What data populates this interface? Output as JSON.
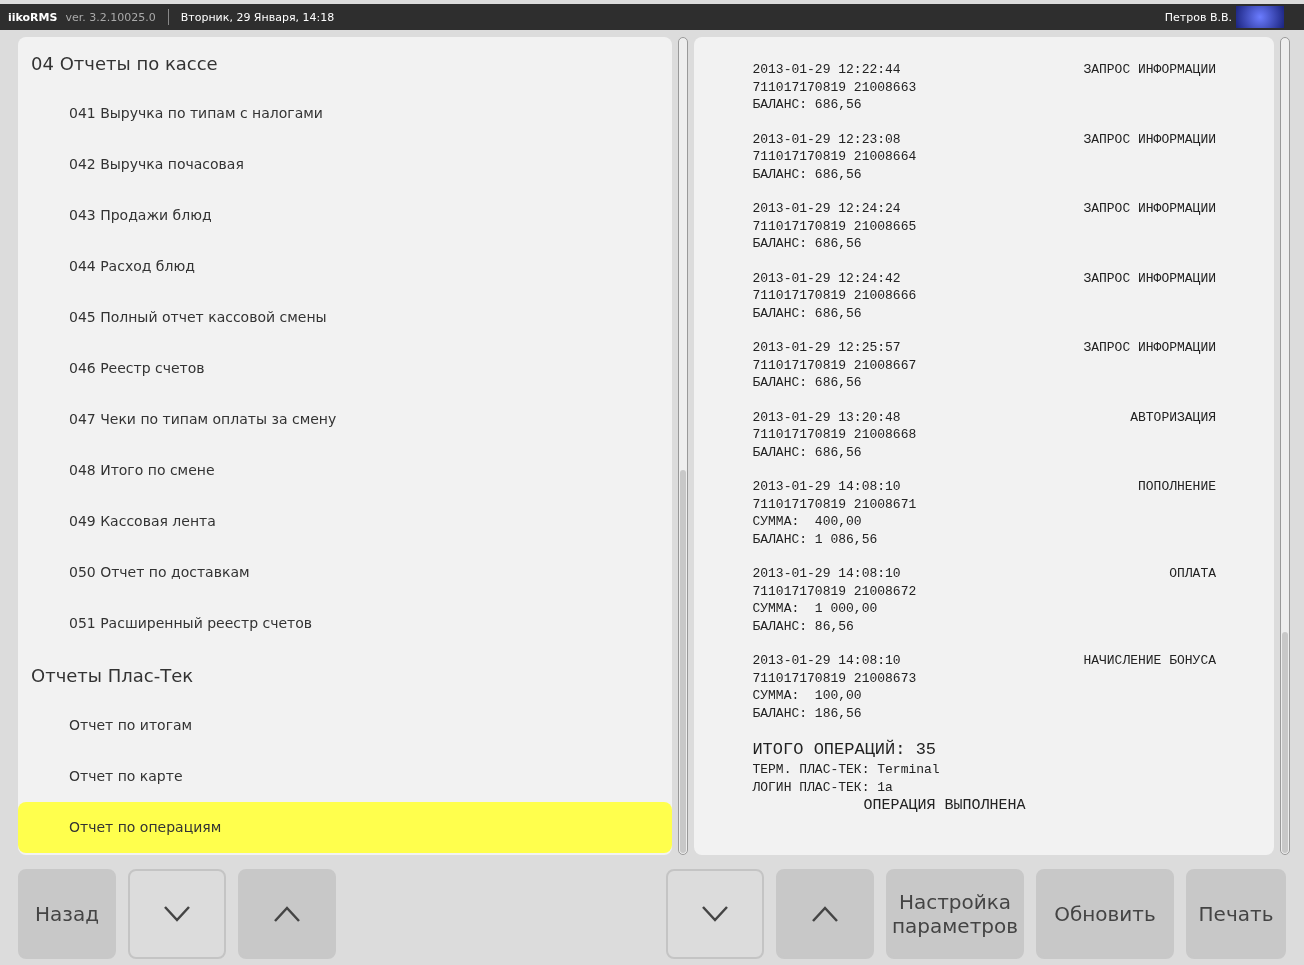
{
  "top_bar": {
    "app_name": "iikoRMS",
    "version": "ver. 3.2.10025.0",
    "datetime": "Вторник, 29 Января, 14:18",
    "user": "Петров В.В."
  },
  "report_list": [
    {
      "kind": "header",
      "label": "04 Отчеты по кассе",
      "selected": false
    },
    {
      "kind": "item",
      "label": "041 Выручка по типам с налогами",
      "selected": false
    },
    {
      "kind": "item",
      "label": "042 Выручка почасовая",
      "selected": false
    },
    {
      "kind": "item",
      "label": "043 Продажи блюд",
      "selected": false
    },
    {
      "kind": "item",
      "label": "044 Расход блюд",
      "selected": false
    },
    {
      "kind": "item",
      "label": "045 Полный отчет кассовой смены",
      "selected": false
    },
    {
      "kind": "item",
      "label": "046 Реестр счетов",
      "selected": false
    },
    {
      "kind": "item",
      "label": "047 Чеки по типам оплаты за смену",
      "selected": false
    },
    {
      "kind": "item",
      "label": "048 Итого по смене",
      "selected": false
    },
    {
      "kind": "item",
      "label": "049 Кассовая лента",
      "selected": false
    },
    {
      "kind": "item",
      "label": "050 Отчет по доставкам",
      "selected": false
    },
    {
      "kind": "item",
      "label": "051 Расширенный реестр счетов",
      "selected": false
    },
    {
      "kind": "header",
      "label": "Отчеты Плас-Тек",
      "selected": false
    },
    {
      "kind": "item",
      "label": "Отчет по итогам",
      "selected": false
    },
    {
      "kind": "item",
      "label": "Отчет по карте",
      "selected": false
    },
    {
      "kind": "item",
      "label": "Отчет по операциям",
      "selected": true
    }
  ],
  "report": {
    "operations": [
      {
        "datetime": "2013-01-29 12:22:44",
        "type": "ЗАПРОС ИНФОРМАЦИИ",
        "card": "711017170819 21008663",
        "lines": [
          "БАЛАНС: 686,56"
        ]
      },
      {
        "datetime": "2013-01-29 12:23:08",
        "type": "ЗАПРОС ИНФОРМАЦИИ",
        "card": "711017170819 21008664",
        "lines": [
          "БАЛАНС: 686,56"
        ]
      },
      {
        "datetime": "2013-01-29 12:24:24",
        "type": "ЗАПРОС ИНФОРМАЦИИ",
        "card": "711017170819 21008665",
        "lines": [
          "БАЛАНС: 686,56"
        ]
      },
      {
        "datetime": "2013-01-29 12:24:42",
        "type": "ЗАПРОС ИНФОРМАЦИИ",
        "card": "711017170819 21008666",
        "lines": [
          "БАЛАНС: 686,56"
        ]
      },
      {
        "datetime": "2013-01-29 12:25:57",
        "type": "ЗАПРОС ИНФОРМАЦИИ",
        "card": "711017170819 21008667",
        "lines": [
          "БАЛАНС: 686,56"
        ]
      },
      {
        "datetime": "2013-01-29 13:20:48",
        "type": "АВТОРИЗАЦИЯ",
        "card": "711017170819 21008668",
        "lines": [
          "БАЛАНС: 686,56"
        ]
      },
      {
        "datetime": "2013-01-29 14:08:10",
        "type": "ПОПОЛНЕНИЕ",
        "card": "711017170819 21008671",
        "lines": [
          "СУММА:  400,00",
          "БАЛАНС: 1 086,56"
        ]
      },
      {
        "datetime": "2013-01-29 14:08:10",
        "type": "ОПЛАТА",
        "card": "711017170819 21008672",
        "lines": [
          "СУММА:  1 000,00",
          "БАЛАНС: 86,56"
        ]
      },
      {
        "datetime": "2013-01-29 14:08:10",
        "type": "НАЧИСЛЕНИЕ БОНУСА",
        "card": "711017170819 21008673",
        "lines": [
          "СУММА:  100,00",
          "БАЛАНС: 186,56"
        ]
      }
    ],
    "total": "ИТОГО ОПЕРАЦИЙ: 35",
    "terminal": "ТЕРМ. ПЛАС-ТЕК: Terminal",
    "login": "ЛОГИН ПЛАС-ТЕК: 1a",
    "status": "ОПЕРАЦИЯ ВЫПОЛНЕНА"
  },
  "left_buttons": [
    {
      "kind": "text",
      "label": "Назад",
      "outlined": false
    },
    {
      "kind": "down",
      "outlined": true
    },
    {
      "kind": "up",
      "outlined": false
    }
  ],
  "right_buttons": [
    {
      "kind": "down",
      "outlined": true
    },
    {
      "kind": "up",
      "outlined": false
    },
    {
      "kind": "text",
      "label": "Настройка параметров",
      "outlined": false
    },
    {
      "kind": "text",
      "label": "Обновить",
      "outlined": false
    },
    {
      "kind": "text",
      "label": "Печать",
      "outlined": false
    }
  ]
}
